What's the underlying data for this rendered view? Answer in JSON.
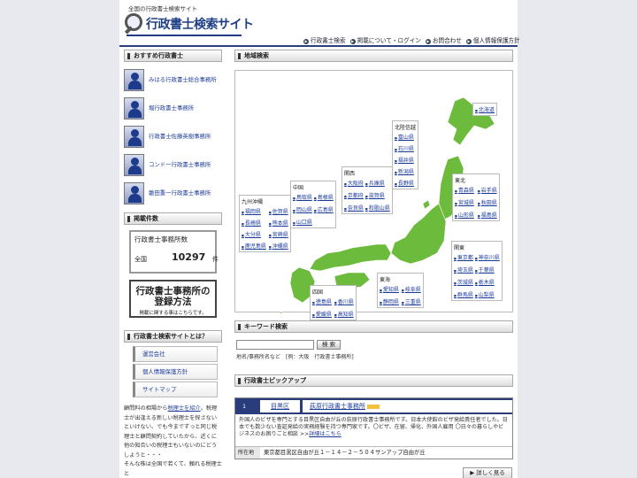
{
  "header": {
    "tagline": "全国の行政書士検索サイト",
    "logo_text": "行政書士検索サイト",
    "nav": [
      "行政書士検索",
      "掲載について・ログイン",
      "お問合わせ",
      "個人情報保護方針"
    ]
  },
  "sidebar": {
    "recommend_title": "おすすめ行政書士",
    "recommended": [
      "みはる行政書士総合事務所",
      "堀行政書士事務所",
      "行政書士佐藤英樹事務所",
      "コンドー行政書士事務所",
      "雛田重一行政書士事務所"
    ],
    "count_title": "掲載件数",
    "count_label": "行政書士事務所数",
    "count_area": "全国",
    "count_value": "10297",
    "count_unit": "件",
    "register_line1": "行政書士事務所の",
    "register_line2": "登録方法",
    "register_sub": "掲載に関する事はこちらです。",
    "about_title": "行政書士検索サイトとは？",
    "about_links": [
      "運営会社",
      "個人情報保護方針",
      "サイトマップ"
    ],
    "text_before_link": "顧問料の相場から",
    "text_link": "税理士を紹介",
    "text_after_link": "。税理士が出逢える新しい税理士を探さないといけない、でも今までずっと同じ税理士と顧問契約していたから、近くに他の知合いの税理士もいないのにどうしようと・・・",
    "text_last": "そんな株は全国で若くて、頼れる税理士と"
  },
  "main": {
    "area_title": "地域検索",
    "regions": [
      {
        "name": "北海道",
        "prefs": [
          "北海道"
        ]
      },
      {
        "name": "北陸信越",
        "prefs": [
          "富山県",
          "石川県",
          "福井県",
          "新潟県",
          "長野県"
        ]
      },
      {
        "name": "東北",
        "prefs": [
          "青森県",
          "岩手県",
          "宮城県",
          "秋田県",
          "山形県",
          "福島県"
        ]
      },
      {
        "name": "関西",
        "prefs": [
          "大阪府",
          "兵庫県",
          "京都府",
          "滋賀県",
          "奈良県",
          "和歌山県"
        ]
      },
      {
        "name": "中国",
        "prefs": [
          "鳥取県",
          "島根県",
          "岡山県",
          "広島県",
          "山口県"
        ]
      },
      {
        "name": "九州沖縄",
        "prefs": [
          "福岡県",
          "佐賀県",
          "長崎県",
          "熊本県",
          "大分県",
          "宮崎県",
          "鹿児島県",
          "沖縄県"
        ]
      },
      {
        "name": "関東",
        "prefs": [
          "東京都",
          "神奈川県",
          "埼玉県",
          "千葉県",
          "茨城県",
          "栃木県",
          "群馬県",
          "山梨県"
        ]
      },
      {
        "name": "東海",
        "prefs": [
          "愛知県",
          "岐阜県",
          "静岡県",
          "三重県"
        ]
      },
      {
        "name": "四国",
        "prefs": [
          "徳島県",
          "香川県",
          "愛媛県",
          "高知県"
        ]
      }
    ],
    "keyword_title": "キーワード検索",
    "keyword_value": "",
    "keyword_button": "検 索",
    "keyword_hint": "地名/事務所名など　[例：大阪　行政書士事務所]",
    "pickup_title": "行政書士ピックアップ",
    "pickup": {
      "no": "1",
      "ward": "目黒区",
      "office": "荻原行政書士事務所",
      "desc": "外国人のビザを専門とする目黒区自由が丘の荻原行政書士事務所です。日本大使館のビザ発給責任者でした。日本でも数少ない査証発給の実務経験を持つ専門家です。〇ビザ、在留、帰化、外国人雇用 〇日々の暮らしやビジネスのお困りごと相談 >>",
      "desc_link": "詳細はこちら",
      "addr_label": "所在地",
      "addr": "東京都目黒区自由が丘１－１４－２－５０４サンアップ自由が丘",
      "detail_button": "詳しく見る"
    }
  },
  "colors": {
    "accent": "#2a3c7c",
    "map_green": "#6cbb3c",
    "link": "#1b3b9b"
  }
}
